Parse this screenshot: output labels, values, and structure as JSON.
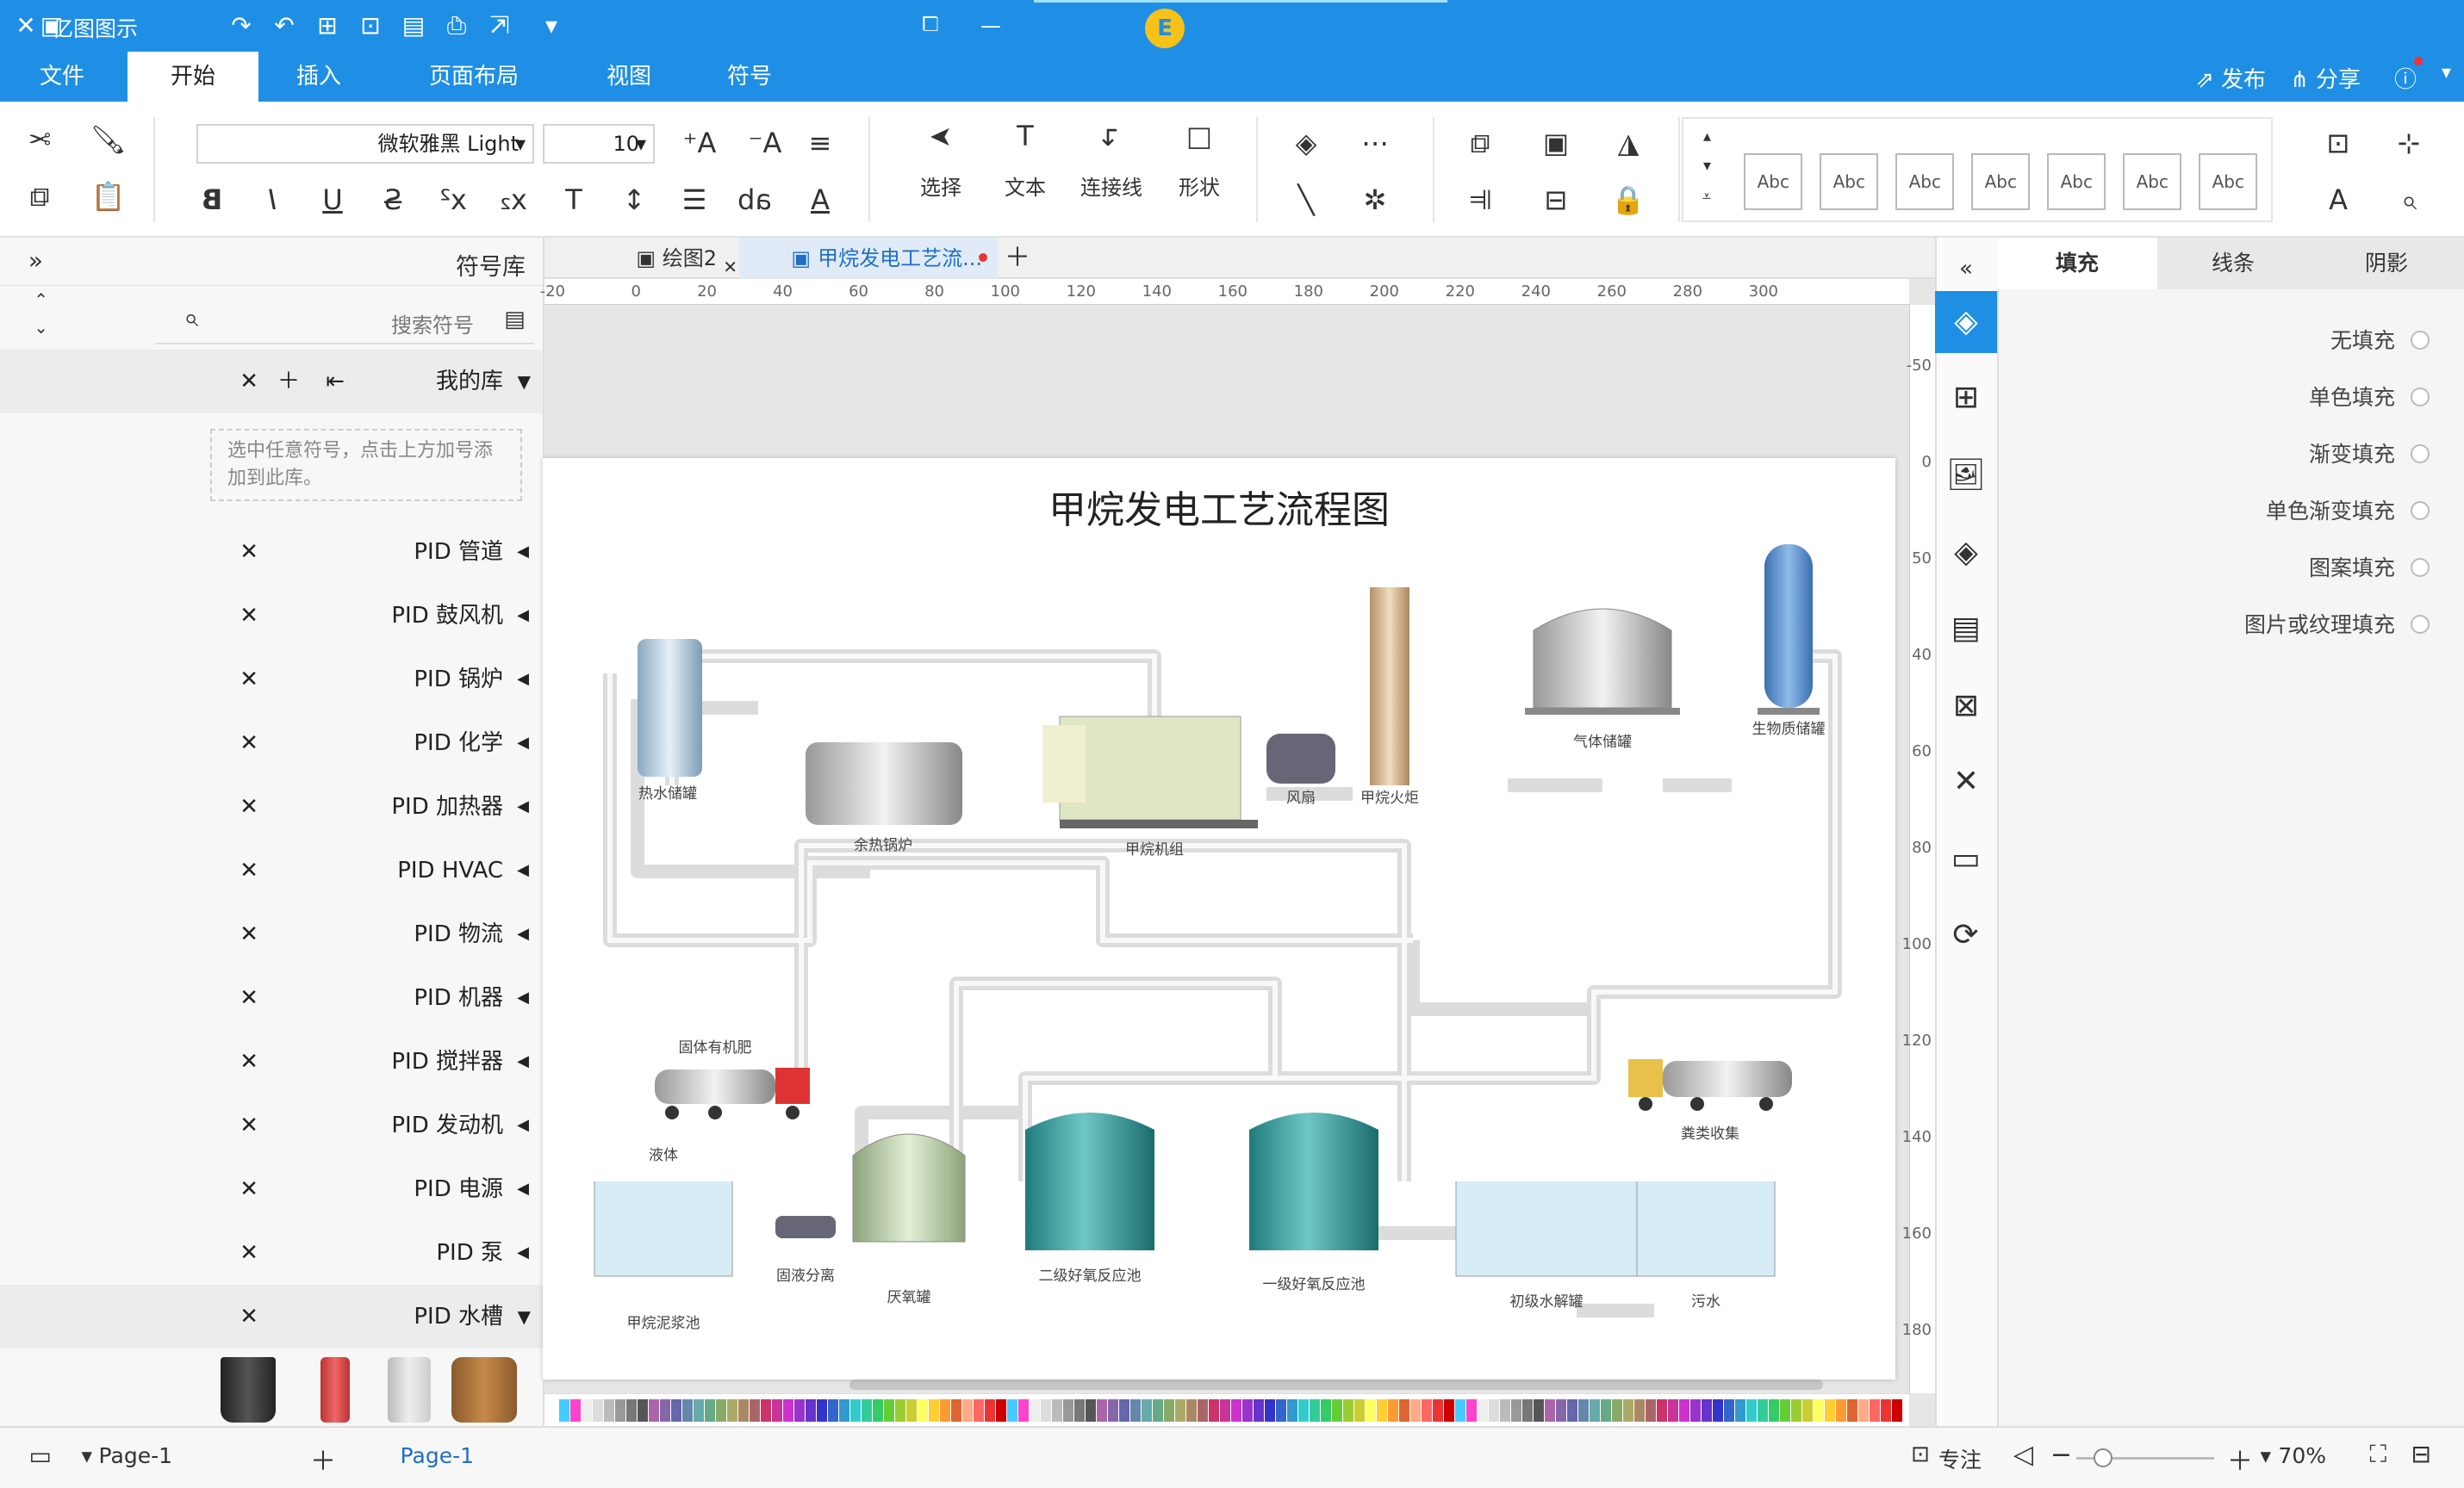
{
  "titlebar": {
    "app_name": "亿图图示",
    "user_initial": "E"
  },
  "menu": {
    "tabs": [
      "文件",
      "开始",
      "插入",
      "页面布局",
      "视图",
      "符号"
    ],
    "active_tab": "开始",
    "publish": "发布",
    "share": "分享"
  },
  "ribbon": {
    "font_name": "微软雅黑 Light",
    "font_size": "10",
    "tools": {
      "select": "选择",
      "text": "文本",
      "connector": "连接线",
      "shape": "形状"
    },
    "style_label": "Abc"
  },
  "library": {
    "title": "符号库",
    "search_placeholder": "搜索符号",
    "my_library": "我的库",
    "my_library_hint": "选中任意符号，点击上方加号添加到此库。",
    "items": [
      "PID 管道",
      "PID 鼓风机",
      "PID 锅炉",
      "PID 化学",
      "PID 加热器",
      "PID HVAC",
      "PID 物流",
      "PID 机器",
      "PID 搅拌器",
      "PID 发动机",
      "PID 电源",
      "PID 泵",
      "PID 水槽"
    ]
  },
  "doc_tabs": {
    "tab1": "绘图2",
    "tab2": "甲烷发电工艺流..."
  },
  "rulers": {
    "h": [
      "-20",
      "0",
      "20",
      "40",
      "60",
      "80",
      "100",
      "120",
      "140",
      "160",
      "180",
      "200",
      "220",
      "240",
      "260",
      "280",
      "300"
    ],
    "v": [
      "-50",
      "0",
      "50",
      "40",
      "60",
      "80",
      "100",
      "120",
      "140",
      "160",
      "180"
    ]
  },
  "diagram": {
    "title": "甲烷发电工艺流程图",
    "labels": {
      "storage_tank": "生物质储罐",
      "gas_holder": "气体储罐",
      "flare": "甲烷火炬",
      "blower": "风扇",
      "generator": "甲烷机组",
      "boiler": "余热锅炉",
      "hot_water": "热水储罐",
      "truck_solid": "固体有机肥",
      "liquid": "液体",
      "slurry_pool": "甲烷泥浆池",
      "separator": "固液分离",
      "digester": "厌氧罐",
      "secondary": "二级好氧反应池",
      "primary": "一级好氧反应池",
      "hydrolysis": "初级水解罐",
      "truck_collect": "粪类收集",
      "sewage": "污水"
    }
  },
  "format_panel": {
    "tabs": [
      "填充",
      "线条",
      "阴影"
    ],
    "active_tab": "填充",
    "options": [
      "无填充",
      "单色填充",
      "渐变填充",
      "单色渐变填充",
      "图案填充",
      "图片或纹理填充"
    ]
  },
  "status": {
    "page_tab": "Page-1",
    "page_name": "Page-1",
    "focus": "专注",
    "zoom": "70%"
  }
}
